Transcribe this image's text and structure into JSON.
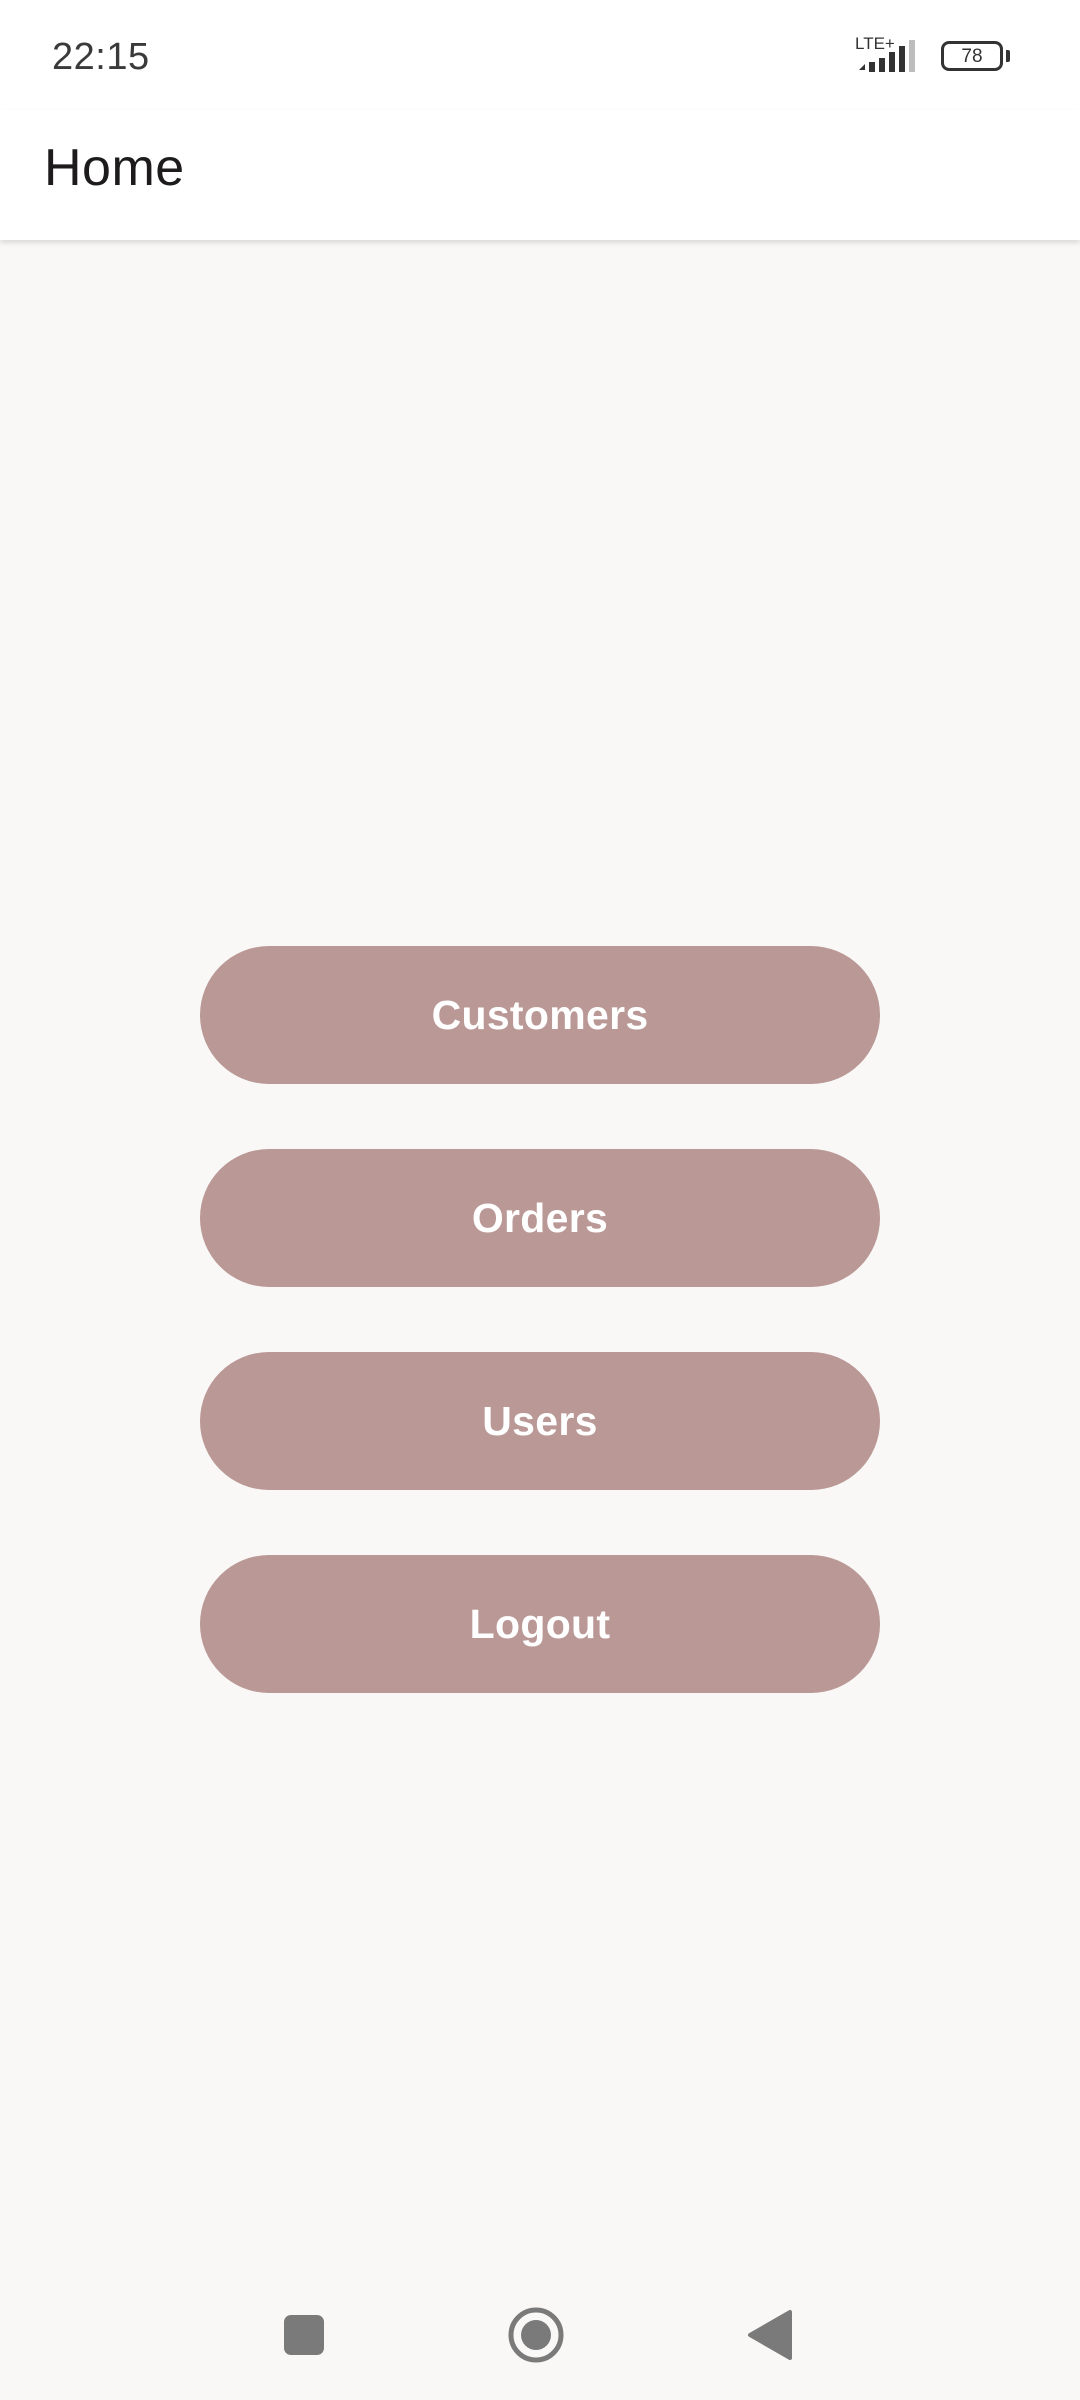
{
  "status_bar": {
    "time": "22:15",
    "network_label": "LTE+",
    "battery_level": "78",
    "signal_icon": "signal-bars-icon",
    "battery_icon": "battery-icon"
  },
  "app_bar": {
    "title": "Home"
  },
  "menu": {
    "buttons": [
      {
        "label": "Customers"
      },
      {
        "label": "Orders"
      },
      {
        "label": "Users"
      },
      {
        "label": "Logout"
      }
    ]
  },
  "nav_bar": {
    "recents_icon": "square-recents-icon",
    "home_icon": "circle-home-icon",
    "back_icon": "triangle-back-icon"
  },
  "colors": {
    "button_background": "#b99896",
    "button_text": "#ffffff",
    "page_background": "#faf8f7",
    "app_bar_background": "#ffffff"
  }
}
